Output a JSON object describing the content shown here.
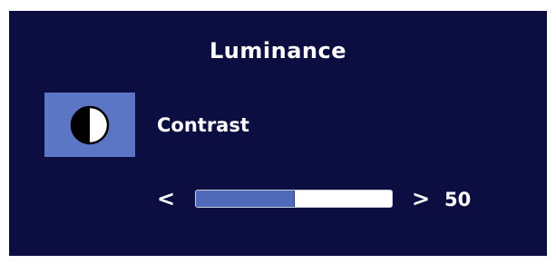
{
  "menu": {
    "title": "Luminance",
    "item": {
      "label": "Contrast",
      "icon": "contrast-icon"
    },
    "slider": {
      "left_arrow": "<",
      "right_arrow": ">",
      "value": "50",
      "fraction": 0.5
    }
  },
  "colors": {
    "background": "#0c0e42",
    "icon_box": "#5b76c5",
    "slider_fill": "#4f6ab8",
    "text": "#ffffff"
  }
}
